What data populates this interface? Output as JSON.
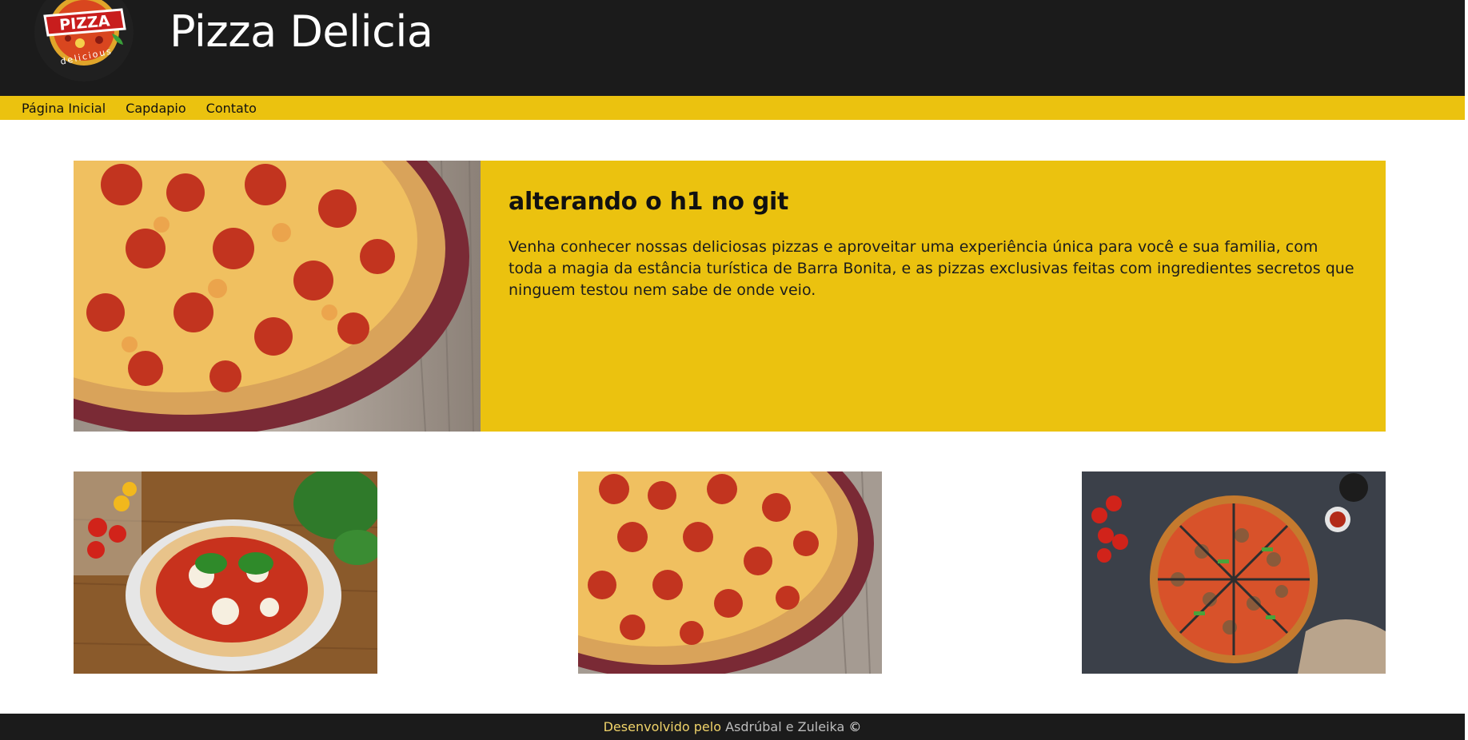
{
  "header": {
    "logo": {
      "main_text": "PIZZA",
      "sub_text": "delicious"
    },
    "title": "Pizza Delicia"
  },
  "nav": {
    "items": [
      {
        "label": "Página Inicial"
      },
      {
        "label": "Capdapio"
      },
      {
        "label": "Contato"
      }
    ]
  },
  "hero": {
    "heading": "alterando o h1 no git",
    "body": "Venha conhecer nossas deliciosas pizzas e aproveitar uma experiência única para você e sua familia, com toda a magia da estância turística de Barra Bonita, e as pizzas exclusivas feitas com ingredientes secretos que ninguem testou nem sabe de onde veio."
  },
  "gallery": {
    "images": [
      {
        "icon": "margherita-pizza-image"
      },
      {
        "icon": "pepperoni-pizza-image"
      },
      {
        "icon": "sliced-pizza-image"
      }
    ]
  },
  "footer": {
    "prefix": "Desenvolvido pelo",
    "authors": "Asdrúbal e Zuleika",
    "copyright": "©"
  },
  "colors": {
    "header_bg": "#1b1b1b",
    "accent_yellow": "#ebc20f",
    "footer_prefix": "#f0d36a",
    "footer_authors": "#bdbdbd"
  }
}
